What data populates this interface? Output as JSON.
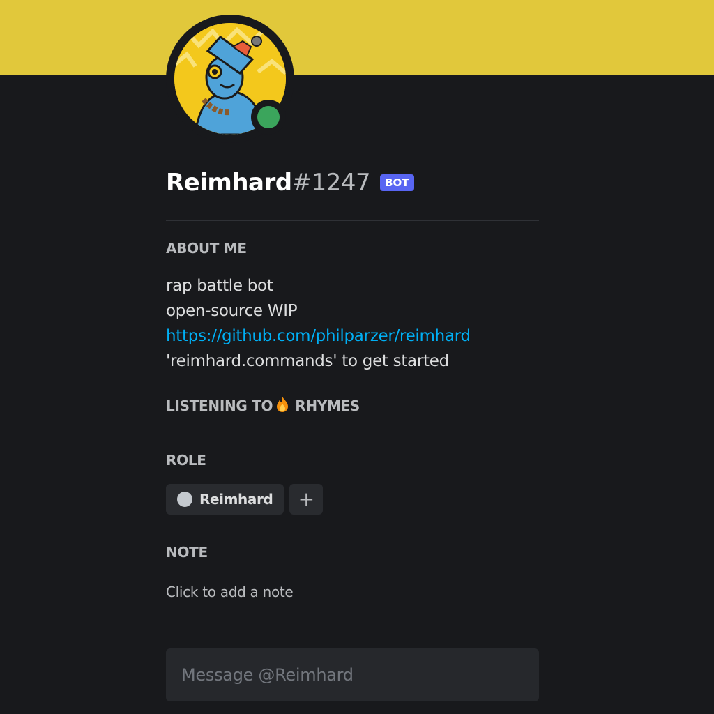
{
  "profile": {
    "username": "Reimhard",
    "discriminator": "#1247",
    "bot_tag": "BOT",
    "status": "online",
    "banner_color": "#e1c83b",
    "status_color": "#3ba55c"
  },
  "about_me": {
    "heading": "ABOUT ME",
    "line1": "rap battle bot",
    "line2": "open-source WIP",
    "link": "https://github.com/philparzer/reimhard",
    "line4": "'reimhard.commands' to get started"
  },
  "activity": {
    "prefix": "LISTENING TO",
    "emoji_icon": "fire-emoji-icon",
    "suffix": "RHYMES"
  },
  "roles": {
    "heading": "ROLE",
    "items": [
      {
        "name": "Reimhard",
        "color": "#c4c9ce"
      }
    ],
    "add_label": "+"
  },
  "note": {
    "heading": "NOTE",
    "placeholder": "Click to add a note"
  },
  "message": {
    "placeholder": "Message @Reimhard"
  }
}
